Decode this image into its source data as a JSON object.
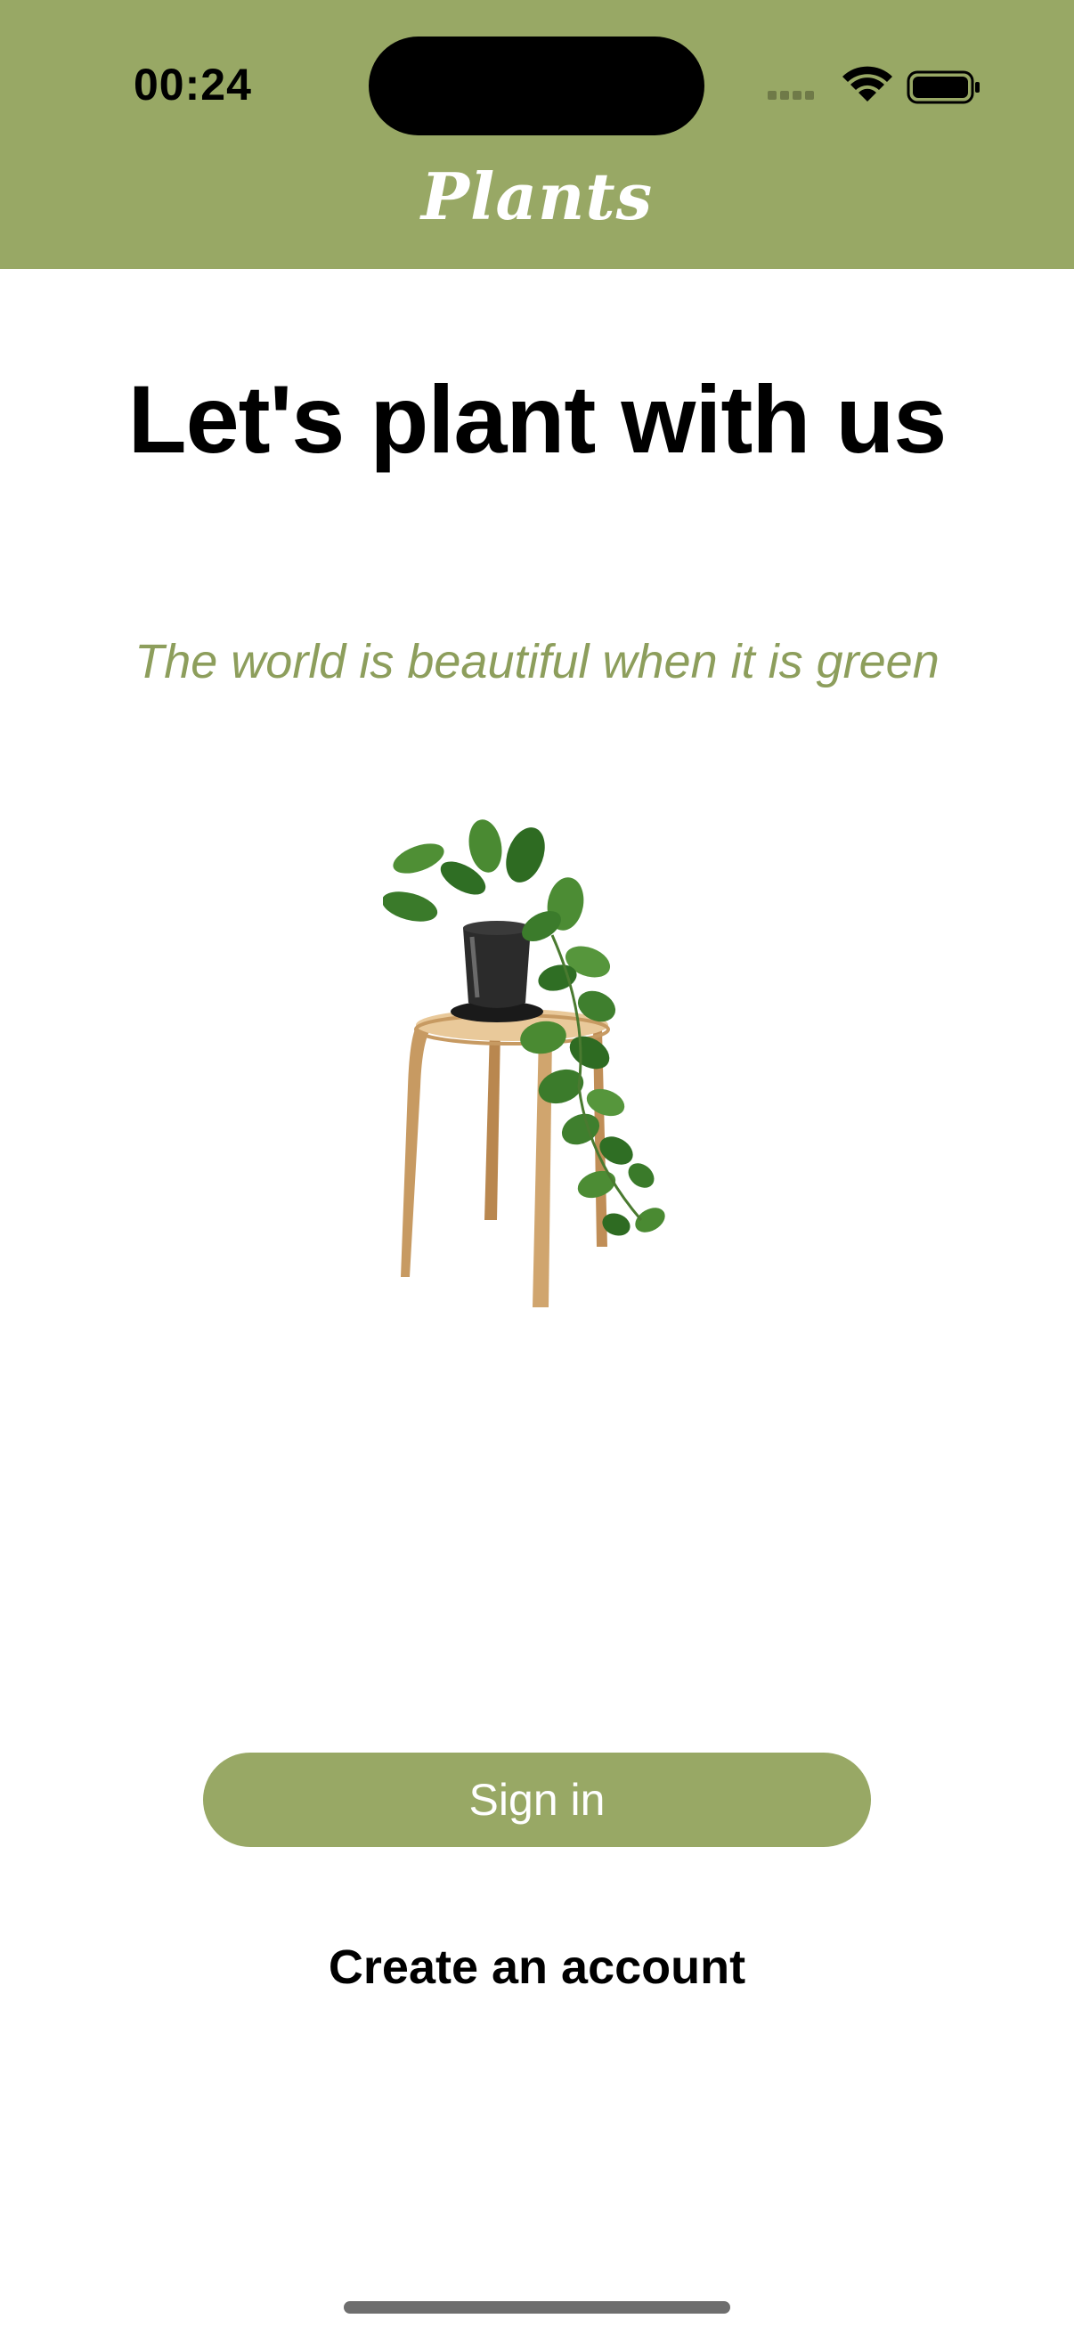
{
  "status_bar": {
    "time": "00:24",
    "icons": [
      "signal-dots-icon",
      "wifi-icon",
      "battery-icon"
    ]
  },
  "header": {
    "title": "Plants",
    "background_color": "#98a865"
  },
  "main": {
    "headline": "Let's plant with us",
    "tagline": "The world is beautiful when it is green",
    "illustration": "potted-plant-on-stool"
  },
  "actions": {
    "sign_in_label": "Sign in",
    "create_account_label": "Create an account"
  },
  "colors": {
    "accent": "#98a865",
    "tagline": "#8d9e5c"
  }
}
